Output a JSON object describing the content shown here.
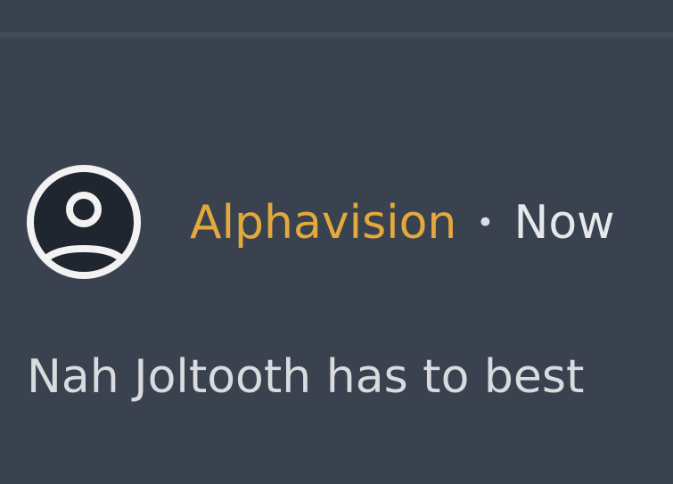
{
  "comment": {
    "author": "Alphavision",
    "separator": "•",
    "timestamp": "Now",
    "text": "Nah Joltooth has to best",
    "avatar_icon": "user-circle-icon"
  },
  "colors": {
    "background": "#3a424f",
    "author": "#e4a93d",
    "text": "#d9dbde",
    "avatar_stroke": "#f2f2f2",
    "avatar_fill": "#1f2630"
  }
}
